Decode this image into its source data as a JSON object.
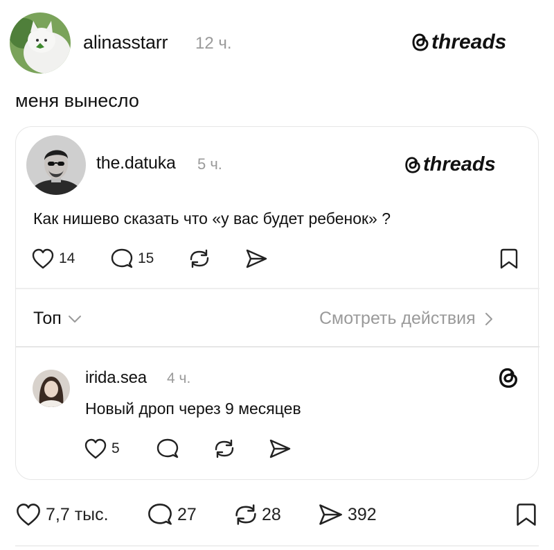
{
  "post": {
    "username": "alinasstarr",
    "time": "12 ч.",
    "brand": "threads",
    "text": "меня вынесло",
    "stats": {
      "likes": "7,7 тыс.",
      "replies": "27",
      "reposts": "28",
      "shares": "392"
    }
  },
  "quoted": {
    "username": "the.datuka",
    "time": "5 ч.",
    "brand": "threads",
    "text": "Как нишево сказать что «у вас будет ребенок» ?",
    "stats": {
      "likes": "14",
      "replies": "15"
    }
  },
  "sort": {
    "label": "Топ",
    "view_activity": "Смотреть действия"
  },
  "reply": {
    "username": "irida.sea",
    "time": "4 ч.",
    "text": "Новый дроп через 9 месяцев",
    "stats": {
      "likes": "5"
    }
  }
}
